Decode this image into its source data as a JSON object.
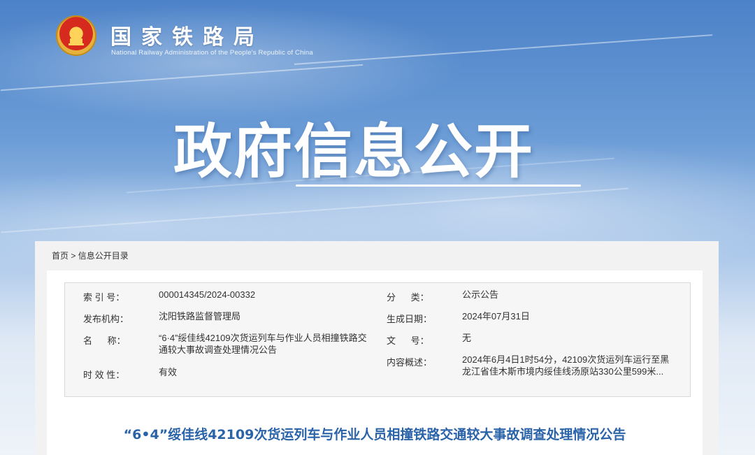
{
  "header": {
    "org_name_cn": "国家铁路局",
    "org_name_en": "National Railway Administration of the People's Republic of China",
    "banner_title": "政府信息公开"
  },
  "breadcrumb": {
    "home": "首页",
    "separator": " > ",
    "current": "信息公开目录"
  },
  "meta": {
    "index_label": "索 引 号：",
    "index_value": "000014345/2024-00332",
    "category_label": "分      类：",
    "category_value": "公示公告",
    "issuer_label": "发布机构：",
    "issuer_value": "沈阳铁路监督管理局",
    "date_label": "生成日期：",
    "date_value": "2024年07月31日",
    "name_label": "名      称：",
    "name_value": "“6·4”绥佳线42109次货运列车与作业人员相撞铁路交通较大事故调查处理情况公告",
    "doc_no_label": "文      号：",
    "doc_no_value": "无",
    "summary_label": "内容概述：",
    "summary_value": "2024年6月4日1时54分，42109次货运列车运行至黑龙江省佳木斯市境内绥佳线汤原站330公里599米...",
    "validity_label": "时 效 性：",
    "validity_value": "有效"
  },
  "article": {
    "title": "“6•4”绥佳线42109次货运列车与作业人员相撞铁路交通较大事故调查处理情况公告"
  },
  "colors": {
    "title_blue": "#2a63a8",
    "panel_bg": "#f2f2f2",
    "meta_bg": "#f6f6f6"
  }
}
